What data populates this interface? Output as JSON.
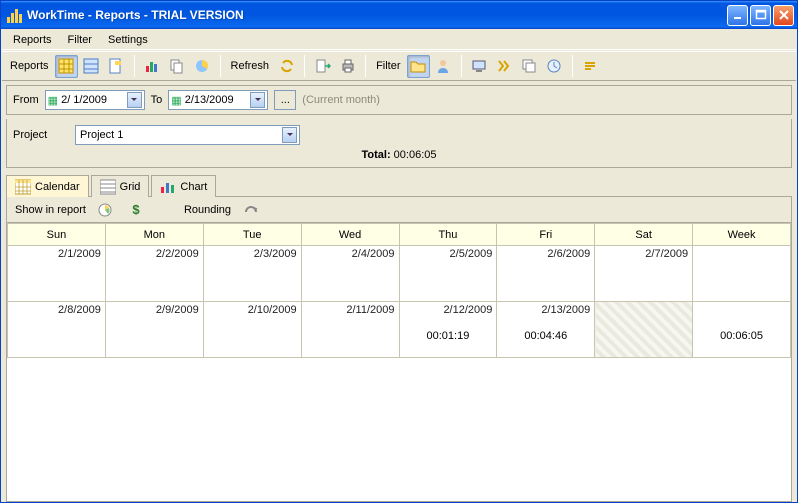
{
  "window": {
    "title": "WorkTime - Reports - TRIAL VERSION"
  },
  "menu": {
    "reports": "Reports",
    "filter": "Filter",
    "settings": "Settings"
  },
  "toolbar": {
    "reports_label": "Reports",
    "refresh_label": "Refresh",
    "filter_label": "Filter"
  },
  "date_filter": {
    "from_label": "From",
    "from_value": "2/ 1/2009",
    "to_label": "To",
    "to_value": "2/13/2009",
    "browse": "...",
    "hint": "(Current month)"
  },
  "project": {
    "label": "Project",
    "value": "Project 1"
  },
  "total": {
    "label": "Total:",
    "value": "00:06:05"
  },
  "tabs": {
    "calendar": "Calendar",
    "grid": "Grid",
    "chart": "Chart"
  },
  "subbar": {
    "show_in_report": "Show in report",
    "rounding": "Rounding"
  },
  "calendar": {
    "headers": [
      "Sun",
      "Mon",
      "Tue",
      "Wed",
      "Thu",
      "Fri",
      "Sat",
      "Week"
    ],
    "rows": [
      {
        "cells": [
          {
            "date": "2/1/2009",
            "value": ""
          },
          {
            "date": "2/2/2009",
            "value": ""
          },
          {
            "date": "2/3/2009",
            "value": ""
          },
          {
            "date": "2/4/2009",
            "value": ""
          },
          {
            "date": "2/5/2009",
            "value": ""
          },
          {
            "date": "2/6/2009",
            "value": ""
          },
          {
            "date": "2/7/2009",
            "value": ""
          },
          {
            "date": "",
            "value": ""
          }
        ]
      },
      {
        "cells": [
          {
            "date": "2/8/2009",
            "value": ""
          },
          {
            "date": "2/9/2009",
            "value": ""
          },
          {
            "date": "2/10/2009",
            "value": ""
          },
          {
            "date": "2/11/2009",
            "value": ""
          },
          {
            "date": "2/12/2009",
            "value": "00:01:19"
          },
          {
            "date": "2/13/2009",
            "value": "00:04:46"
          },
          {
            "date": "",
            "value": "",
            "disabled": true
          },
          {
            "date": "",
            "value": "00:06:05"
          }
        ]
      }
    ]
  }
}
